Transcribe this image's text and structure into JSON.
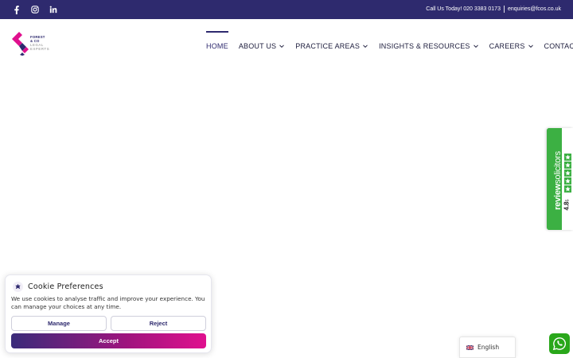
{
  "topbar": {
    "social": [
      "facebook-icon",
      "instagram-icon",
      "linkedin-icon"
    ],
    "phone_text": "Call Us Today! 020 3383 0173",
    "email": "enquiries@fcos.co.uk"
  },
  "logo": {
    "line1": "FOREST",
    "line2": "& CO",
    "line3": "LEGAL",
    "line4": "EXPERTS"
  },
  "nav": {
    "items": [
      {
        "label": "HOME",
        "active": true
      },
      {
        "label": "ABOUT US",
        "dropdown": true
      },
      {
        "label": "PRACTICE AREAS",
        "dropdown": true
      },
      {
        "label": "INSIGHTS & RESOURCES",
        "dropdown": true
      },
      {
        "label": "CAREERS",
        "dropdown": true
      },
      {
        "label": "CONTACT"
      }
    ],
    "search_icon": "search-icon"
  },
  "review_widget": {
    "brand_a": "review",
    "brand_b": "solicitors",
    "rating": "4.8",
    "rating_max": "5",
    "stars": 5,
    "color": "#3cb043"
  },
  "cookie": {
    "title": "Cookie Preferences",
    "message": "We use cookies to analyse traffic and improve your experience. You can manage your choices at any time.",
    "manage_label": "Manage",
    "reject_label": "Reject",
    "accept_label": "Accept"
  },
  "language": {
    "selected": "English"
  },
  "colors": {
    "brand_navy": "#2e2a6e",
    "brand_magenta": "#e0108e",
    "whatsapp": "#29a71a"
  }
}
